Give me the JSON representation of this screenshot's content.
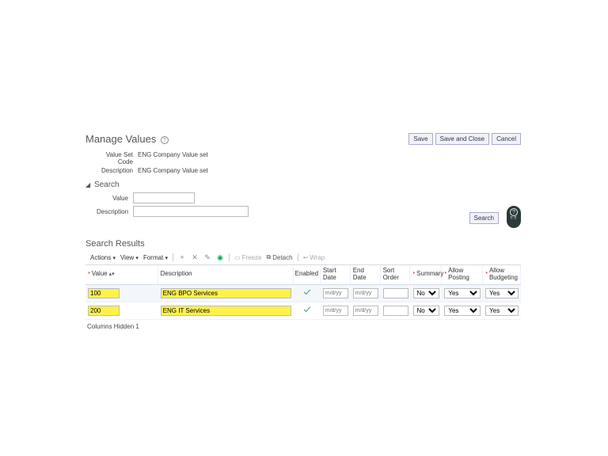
{
  "header": {
    "title": "Manage Values",
    "buttons": {
      "save": "Save",
      "save_close": "Save and Close",
      "cancel": "Cancel"
    }
  },
  "meta": {
    "code_label": "Value Set Code",
    "code_value": "ENG Company Value set",
    "desc_label": "Description",
    "desc_value": "ENG Company Value set"
  },
  "search": {
    "title": "Search",
    "value_label": "Value",
    "desc_label": "Description",
    "search_btn": "Search"
  },
  "results": {
    "title": "Search Results",
    "toolbar": {
      "actions": "Actions",
      "view": "View",
      "format": "Format",
      "freeze": "Freeze",
      "detach": "Detach",
      "wrap": "Wrap"
    },
    "columns": {
      "value": "Value",
      "description": "Description",
      "enabled": "Enabled",
      "start_date": "Start Date",
      "end_date": "End Date",
      "sort_order": "Sort Order",
      "summary": "Summary",
      "allow_posting": "Allow Posting",
      "allow_budgeting": "Allow Budgeting"
    },
    "placeholders": {
      "date": "m/d/yy"
    },
    "options": {
      "yesno": [
        "No",
        "Yes"
      ]
    },
    "rows": [
      {
        "value": "100",
        "description": "ENG BPO Services",
        "enabled": true,
        "start_date": "",
        "end_date": "",
        "sort_order": "",
        "summary": "No",
        "allow_posting": "Yes",
        "allow_budgeting": "Yes"
      },
      {
        "value": "200",
        "description": "ENG IT Services",
        "enabled": true,
        "start_date": "",
        "end_date": "",
        "sort_order": "",
        "summary": "No",
        "allow_posting": "Yes",
        "allow_budgeting": "Yes"
      }
    ],
    "footer_label": "Columns Hidden",
    "footer_count": "1"
  }
}
